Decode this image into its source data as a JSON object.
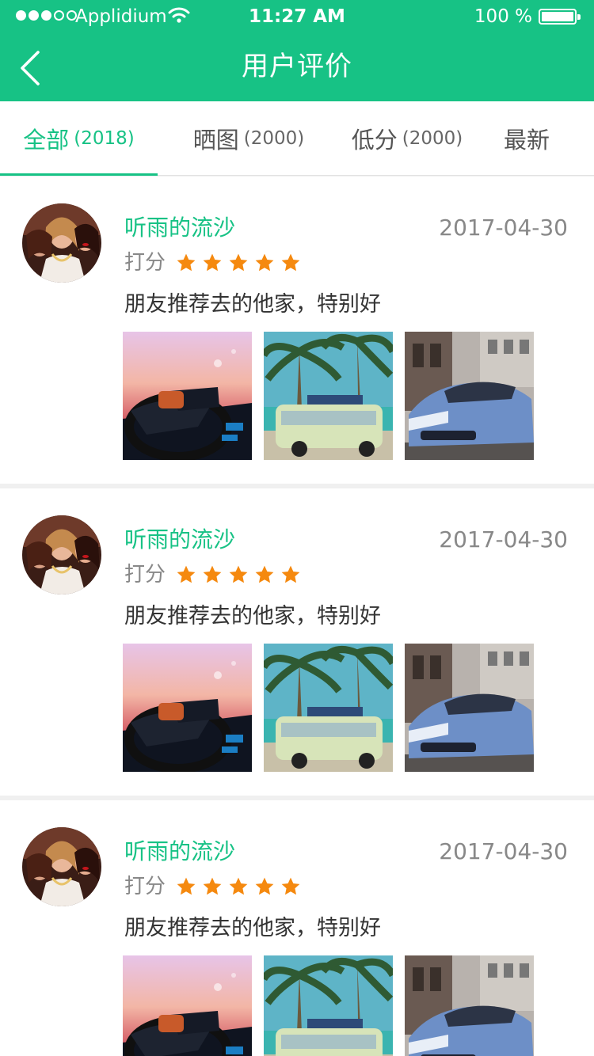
{
  "status_bar": {
    "carrier": "Applidium",
    "time": "11:27 AM",
    "battery": "100 %"
  },
  "nav": {
    "title": "用户评价",
    "back_icon": "chevron-left-icon"
  },
  "tabs": [
    {
      "label": "全部",
      "count": "(2018)",
      "active": true
    },
    {
      "label": "晒图",
      "count": "(2000)",
      "active": false
    },
    {
      "label": "低分",
      "count": "(2000)",
      "active": false
    },
    {
      "label": "最新",
      "count": "",
      "active": false
    }
  ],
  "reviews": [
    {
      "name": "听雨的流沙",
      "date": "2017-04-30",
      "rating_label": "打分",
      "rating": 5,
      "text": "朋友推荐去的他家，特别好"
    },
    {
      "name": "听雨的流沙",
      "date": "2017-04-30",
      "rating_label": "打分",
      "rating": 5,
      "text": "朋友推荐去的他家，特别好"
    },
    {
      "name": "听雨的流沙",
      "date": "2017-04-30",
      "rating_label": "打分",
      "rating": 5,
      "text": "朋友推荐去的他家，特别好"
    }
  ],
  "colors": {
    "accent": "#17c285",
    "star": "#f5890f"
  }
}
